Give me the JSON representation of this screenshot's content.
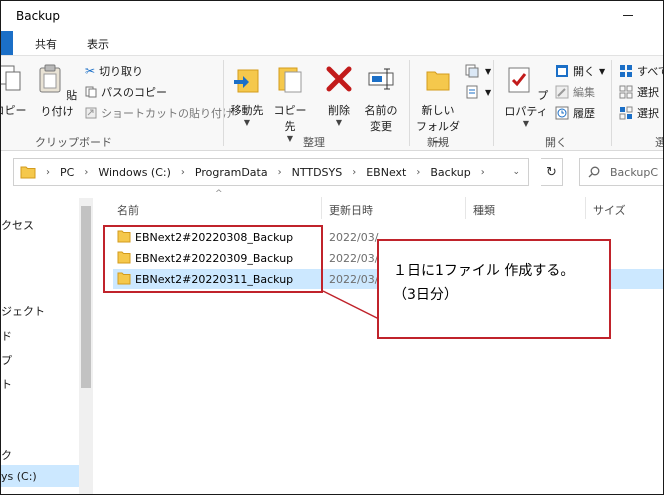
{
  "window": {
    "title": "Backup"
  },
  "tabs": {
    "share": "共有",
    "view": "表示"
  },
  "ribbon": {
    "clipboard": {
      "copy_partial": "コピー",
      "paste": "貼り付け",
      "cut": "切り取り",
      "copy_path": "パスのコピー",
      "paste_shortcut": "ショートカットの貼り付け",
      "group": "クリップボード"
    },
    "organize": {
      "move_to": "移動先",
      "copy_to": "コピー先",
      "delete": "削除",
      "rename_line1": "名前の",
      "rename_line2": "変更",
      "group": "整理"
    },
    "new": {
      "new_folder_line1": "新しい",
      "new_folder_line2": "フォルダー",
      "group": "新規"
    },
    "open": {
      "properties": "プロパティ",
      "open": "開く",
      "edit": "編集",
      "history": "履歴",
      "group": "開く"
    },
    "select": {
      "select_all_partial": "すべて",
      "select_none_partial": "選択",
      "invert_partial": "選択",
      "group_partial": "選"
    }
  },
  "address": {
    "crumbs": [
      "PC",
      "Windows (C:)",
      "ProgramData",
      "NTTDSYS",
      "EBNext",
      "Backup"
    ],
    "search_placeholder": "BackupC"
  },
  "nav": {
    "items": [
      "クセス",
      "ジェクト",
      "ド",
      "プ",
      "ト",
      "ク",
      "ys (C:)"
    ]
  },
  "columns": {
    "name": "名前",
    "date": "更新日時",
    "type": "種類",
    "size": "サイズ"
  },
  "files": [
    {
      "name": "EBNext2#20220308_Backup",
      "date": "2022/03/",
      "selected": false
    },
    {
      "name": "EBNext2#20220309_Backup",
      "date": "2022/03/",
      "selected": false
    },
    {
      "name": "EBNext2#20220311_Backup",
      "date": "2022/03/",
      "selected": true
    }
  ],
  "annotation": {
    "line1": "１日に1ファイル 作成する。",
    "line2": "（3日分）"
  },
  "colors": {
    "accent": "#1b6fc7",
    "annotation": "#c0232b",
    "selection": "#cce8ff",
    "folder": "#f5c84c"
  }
}
